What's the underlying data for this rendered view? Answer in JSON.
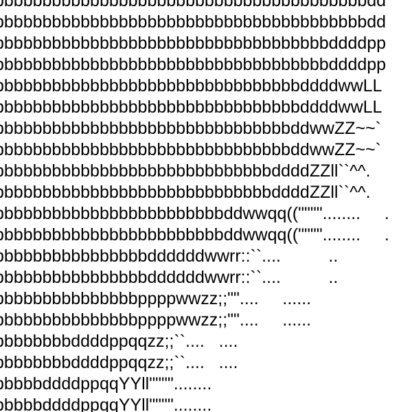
{
  "art": {
    "lines": [
      "bbbbbbbbbbbbbbbbbbbbbbbbbbbbbbbbbbbbbbbdd",
      "bbbbbbbbbbbbbbbbbbbbbbbbbbbbbbbbbbbbbbbdd",
      "bbbbbbbbbbbbbbbbbbbbbbbbbbbbbbbbbbbddddpp",
      "bbbbbbbbbbbbbbbbbbbbbbbbbbbbbbbbbbbddddpp",
      "bbbbbbbbbbbbbbbbbbbbbbbbbbbbbbbbddddwwLL",
      "bbbbbbbbbbbbbbbbbbbbbbbbbbbbbbbbddddwwLL",
      "bbbbbbbbbbbbbbbbbbbbbbbbbbbbbbbddwwZZ~~`",
      "bbbbbbbbbbbbbbbbbbbbbbbbbbbbbbbddwwZZ~~`",
      "bbbbbbbbbbbbbbbbbbbbbbbbbbbbbddddZZll``^^.",
      "bbbbbbbbbbbbbbbbbbbbbbbbbbbbbddddZZll``^^.",
      "bbbbbbbbbbbbbbbbbbbbbbbbddwwqq((\"\"\"\"........     .",
      "bbbbbbbbbbbbbbbbbbbbbbbbddwwqq((\"\"\"\"........     .",
      "bbbbbbbbbbbbbbbbddddddwwrr::``....          ..",
      "bbbbbbbbbbbbbbbbddddddwwrr::``....          ..",
      "bbbbbbbbbbbbbbbppppwwzz;;\"\"....     ......",
      "bbbbbbbbbbbbbbbppppwwzz;;\"\"....     ......",
      "bbbbbbbbddddppqqzz;;``....   ....",
      "bbbbbbbbddddppqqzz;;``....   ....",
      "bbbbbddddppqqYYll\"\"\"\"........",
      "bbbbbddddppqqYYll\"\"\"\"........"
    ]
  }
}
